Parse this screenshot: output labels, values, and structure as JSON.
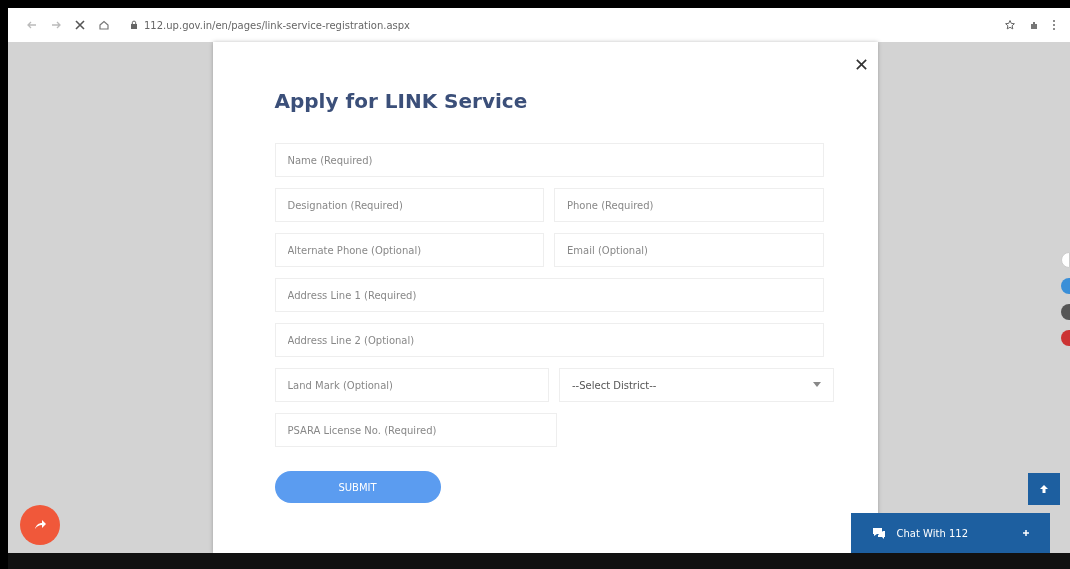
{
  "browser": {
    "url": "112.up.gov.in/en/pages/link-service-registration.aspx"
  },
  "modal": {
    "title": "Apply for LINK Service",
    "rows": [
      [
        {
          "kind": "input",
          "placeholder": "Name (Required)"
        }
      ],
      [
        {
          "kind": "input",
          "placeholder": "Designation (Required)"
        },
        {
          "kind": "input",
          "placeholder": "Phone (Required)"
        }
      ],
      [
        {
          "kind": "input",
          "placeholder": "Alternate Phone (Optional)"
        },
        {
          "kind": "input",
          "placeholder": "Email (Optional)"
        }
      ],
      [
        {
          "kind": "input",
          "placeholder": "Address Line 1 (Required)"
        }
      ],
      [
        {
          "kind": "input",
          "placeholder": "Address Line 2 (Optional)"
        }
      ],
      [
        {
          "kind": "input",
          "placeholder": "Land Mark (Optional)"
        },
        {
          "kind": "select",
          "value": "--Select District--"
        }
      ],
      [
        {
          "kind": "input",
          "placeholder": "PSARA License No. (Required)"
        },
        {
          "kind": "blank"
        }
      ]
    ],
    "submit": "SUBMIT"
  },
  "chat": {
    "label": "Chat With 112"
  }
}
